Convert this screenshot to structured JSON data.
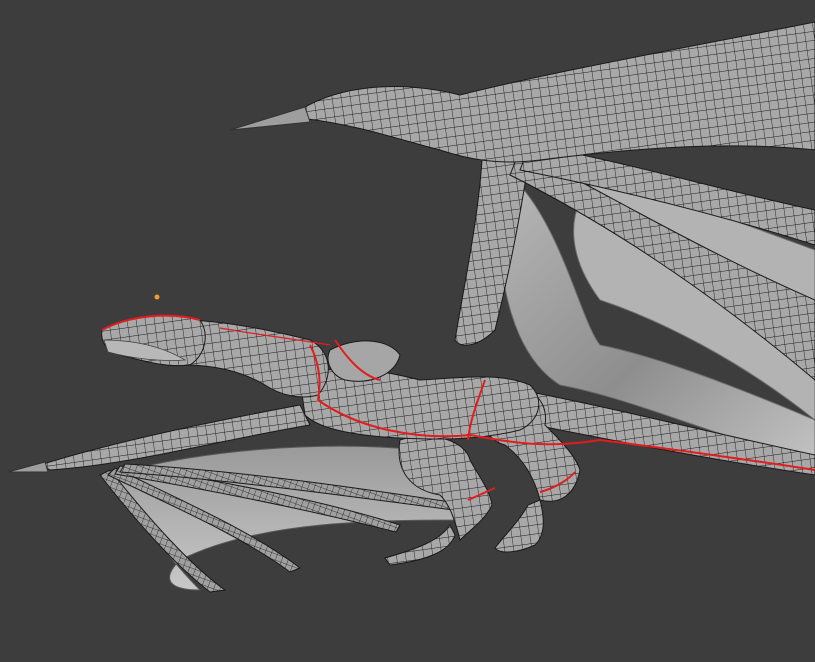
{
  "viewport": {
    "background": "#3d3d3d",
    "mode": "edit-mode-wireframe-overlay"
  },
  "model": {
    "mesh_color": "#a9a9a9",
    "wire_color": "#1a1a1a",
    "seam_color": "#e31d1d",
    "origin_point_color": "#f29a2e"
  }
}
